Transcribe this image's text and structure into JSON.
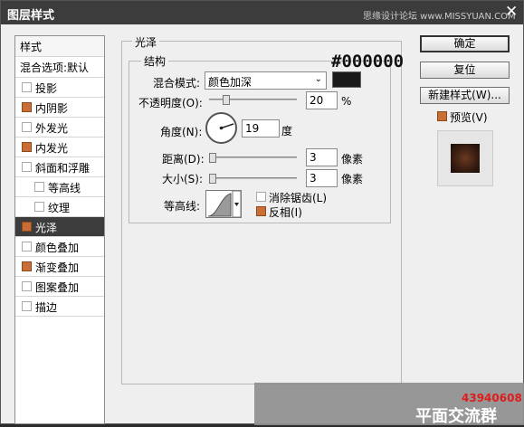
{
  "window": {
    "title": "图层样式",
    "watermark": "思缘设计论坛 www.MISSYUAN.COM",
    "close": "✕"
  },
  "stylelist": {
    "header": "样式",
    "blend_default": "混合选项:默认",
    "items": [
      {
        "label": "投影",
        "checked": false,
        "indent": false
      },
      {
        "label": "内阴影",
        "checked": true,
        "indent": false
      },
      {
        "label": "外发光",
        "checked": false,
        "indent": false
      },
      {
        "label": "内发光",
        "checked": true,
        "indent": false
      },
      {
        "label": "斜面和浮雕",
        "checked": false,
        "indent": false
      },
      {
        "label": "等高线",
        "checked": false,
        "indent": true
      },
      {
        "label": "纹理",
        "checked": false,
        "indent": true
      },
      {
        "label": "光泽",
        "checked": true,
        "indent": false,
        "selected": true
      },
      {
        "label": "颜色叠加",
        "checked": false,
        "indent": false
      },
      {
        "label": "渐变叠加",
        "checked": true,
        "indent": false
      },
      {
        "label": "图案叠加",
        "checked": false,
        "indent": false
      },
      {
        "label": "描边",
        "checked": false,
        "indent": false
      }
    ]
  },
  "satin": {
    "section": "光泽",
    "structure": "结构",
    "blend_mode_label": "混合模式:",
    "blend_mode_value": "颜色加深",
    "color_hex_note": "#000000",
    "opacity_label": "不透明度(O):",
    "opacity_value": "20",
    "opacity_unit": "%",
    "angle_label": "角度(N):",
    "angle_value": "19",
    "angle_unit": "度",
    "distance_label": "距离(D):",
    "distance_value": "3",
    "distance_unit": "像素",
    "size_label": "大小(S):",
    "size_value": "3",
    "size_unit": "像素",
    "contour_label": "等高线:",
    "antialias_label": "消除锯齿(L)",
    "antialias_checked": false,
    "invert_label": "反相(I)",
    "invert_checked": true
  },
  "buttons": {
    "ok": "确定",
    "reset": "复位",
    "new_style": "新建样式(W)...",
    "preview_label": "预览(V)",
    "preview_checked": true
  },
  "overlay": {
    "qq": "43940608",
    "group": "平面交流群"
  },
  "colors": {
    "accent": "#c96f35",
    "title_bg": "#3c3c3c"
  }
}
